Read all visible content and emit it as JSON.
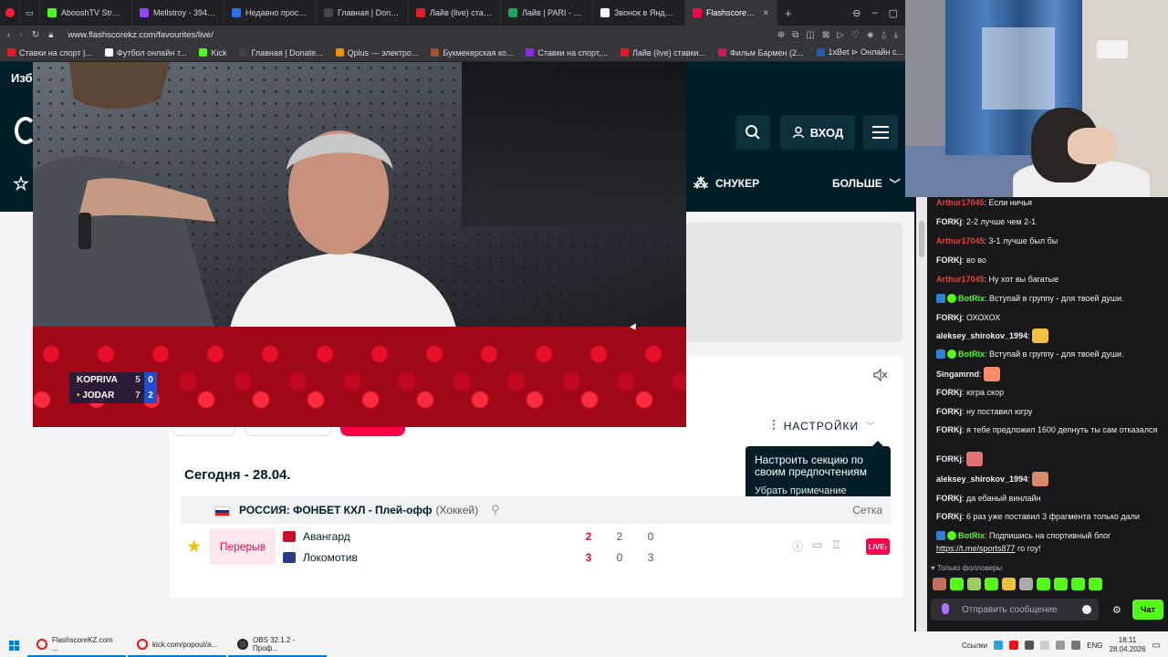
{
  "browser": {
    "tabs": [
      {
        "label": "AbooshTV Stream",
        "color": "#53fc18"
      },
      {
        "label": "Mellstroy - 394243",
        "color": "#9147ff"
      },
      {
        "label": "Недавно прослуш...",
        "color": "#2f6fed"
      },
      {
        "label": "Главная | DonateP...",
        "color": "#444444"
      },
      {
        "label": "Лайв (live) став...",
        "color": "#e11d2a"
      },
      {
        "label": "Лайв | PARI - Лайв",
        "color": "#1fa35a"
      },
      {
        "label": "Звонок в Яндекс Т...",
        "color": "#f5f5f5"
      },
      {
        "label": "FlashscoreKZ.com - Избр...",
        "color": "#ff0046"
      }
    ],
    "url": "www.flashscorekz.com/favourites/live/",
    "bookmarks": [
      {
        "label": "Ставки на спорт |...",
        "color": "#e11d2a"
      },
      {
        "label": "Футбол онлайн т...",
        "color": "#ffffff"
      },
      {
        "label": "Kick",
        "color": "#53fc18"
      },
      {
        "label": "Главная | Donate...",
        "color": "#444444"
      },
      {
        "label": "Qplus — электро...",
        "color": "#f29100"
      },
      {
        "label": "Букмекерская ко...",
        "color": "#a0522d"
      },
      {
        "label": "Ставки на спорт,...",
        "color": "#8a2be2"
      },
      {
        "label": "Лайв (live) ставки...",
        "color": "#e11d2a"
      },
      {
        "label": "Фильм Бармен (2...",
        "color": "#d4145a"
      },
      {
        "label": "1xBet ⊳ Онлайн с...",
        "color": "#1a5fb4"
      }
    ]
  },
  "site": {
    "page_heading": "Избр",
    "login_label": "ВХОД",
    "nav_snooker": "СНУКЕР",
    "nav_more": "БОЛЬШЕ",
    "settings_label": "НАСТРОЙКИ",
    "date_heading": "Сегодня - 28.04.",
    "tooltip_text": "Настроить секцию по своим предпочтениям",
    "tooltip_dismiss": "Убрать примечание",
    "league_name": "РОССИЯ: ФОНБЕТ КХЛ - Плей-офф",
    "league_sport": "(Хоккей)",
    "bracket_label": "Сетка",
    "match": {
      "status": "Перерыв",
      "home": "Авангард",
      "away": "Локомотив",
      "home_total": "2",
      "away_total": "3",
      "home_p1": "2",
      "away_p1": "0",
      "home_p2": "0",
      "away_p2": "3",
      "live_label": "LIVE"
    }
  },
  "video": {
    "scoreboard": [
      {
        "player": "KOPRIVA",
        "games": "5",
        "set": "0",
        "serving": false
      },
      {
        "player": "JODAR",
        "games": "7",
        "set": "2",
        "serving": true
      }
    ]
  },
  "chat": {
    "messages": [
      {
        "user": "Arthur17045",
        "color": "#e2433b",
        "text": "Если ничья"
      },
      {
        "user": "FORKj",
        "color": "#efeff1",
        "text": "2-2 лучше чем 2-1"
      },
      {
        "user": "Arthur17045",
        "color": "#e2433b",
        "text": "3-1 лучше был бы"
      },
      {
        "user": "FORKj",
        "color": "#efeff1",
        "text": "во во"
      },
      {
        "user": "Arthur17045",
        "color": "#e2433b",
        "text": "Ну хот вы багатые"
      },
      {
        "user": "BotRix",
        "color": "#53fc18",
        "text": "Вступай в группу - для твоей души."
      },
      {
        "user": "FORKj",
        "color": "#efeff1",
        "text": "ОХОХОХ"
      },
      {
        "user": "aleksey_shirokov_1994",
        "color": "#efeff1",
        "text": ""
      },
      {
        "user": "BotRix",
        "color": "#53fc18",
        "text": "Вступай в группу - для твоей души."
      },
      {
        "user": "Singamrnd",
        "color": "#efeff1",
        "text": ""
      },
      {
        "user": "FORKj",
        "color": "#efeff1",
        "text": "югра скор"
      },
      {
        "user": "FORKj",
        "color": "#efeff1",
        "text": "ну поставил югру"
      },
      {
        "user": "FORKj",
        "color": "#efeff1",
        "text": "я тебе предложил 1600 депнуть ты сам отказался"
      },
      {
        "user": "FORKj",
        "color": "#efeff1",
        "text": ""
      },
      {
        "user": "aleksey_shirokov_1994",
        "color": "#efeff1",
        "text": ""
      },
      {
        "user": "FORKj",
        "color": "#efeff1",
        "text": "да ебаный винлайн"
      },
      {
        "user": "FORKj",
        "color": "#efeff1",
        "text": "6 раз уже поставил 3 фрагмента только дали"
      },
      {
        "user": "BotRix",
        "color": "#53fc18",
        "text": "Подпишись на спортивный блог"
      }
    ],
    "last_link": "https://t.me/sports877",
    "last_suffix": " го гоу!",
    "followers_only": "Только фолловеры",
    "input_placeholder": "Отправить сообщение",
    "send_label": "Чат"
  },
  "taskbar": {
    "apps": [
      "FlashscoreKZ.com ...",
      "kick.com/popout/a...",
      "OBS 32.1.2 - Проф..."
    ],
    "links_label": "Ссылки",
    "lang": "ENG",
    "time": "18:11",
    "date": "28.04.2026"
  }
}
